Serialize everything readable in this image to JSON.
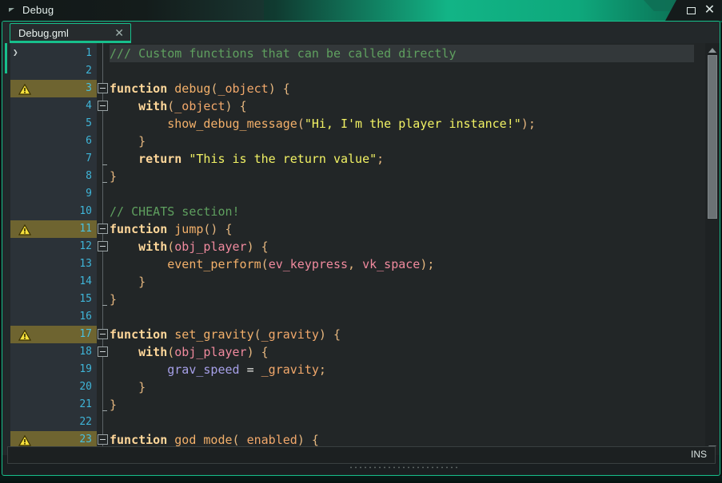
{
  "window": {
    "title": "Debug",
    "collapse_icon": "triangle-left-icon",
    "maximize_label": "maximize-icon",
    "close_label": "✕"
  },
  "tabs": [
    {
      "label": "Debug.gml",
      "close": "✕",
      "active": true
    }
  ],
  "status": {
    "insert_mode": "INS"
  },
  "scrollbar": {
    "up_arrow": "scroll-up-icon",
    "down_arrow": "scroll-down-icon"
  },
  "gutter": {
    "cursor_glyph": "❯",
    "warning_glyph": "warning-icon",
    "lines": [
      {
        "n": "1",
        "warn": false
      },
      {
        "n": "2",
        "warn": false
      },
      {
        "n": "3",
        "warn": true
      },
      {
        "n": "4",
        "warn": false
      },
      {
        "n": "5",
        "warn": false
      },
      {
        "n": "6",
        "warn": false
      },
      {
        "n": "7",
        "warn": false
      },
      {
        "n": "8",
        "warn": false
      },
      {
        "n": "9",
        "warn": false
      },
      {
        "n": "10",
        "warn": false
      },
      {
        "n": "11",
        "warn": true
      },
      {
        "n": "12",
        "warn": false
      },
      {
        "n": "13",
        "warn": false
      },
      {
        "n": "14",
        "warn": false
      },
      {
        "n": "15",
        "warn": false
      },
      {
        "n": "16",
        "warn": false
      },
      {
        "n": "17",
        "warn": true
      },
      {
        "n": "18",
        "warn": false
      },
      {
        "n": "19",
        "warn": false
      },
      {
        "n": "20",
        "warn": false
      },
      {
        "n": "21",
        "warn": false
      },
      {
        "n": "22",
        "warn": false
      },
      {
        "n": "23",
        "warn": true
      }
    ]
  },
  "code": {
    "language": "gml",
    "current_line": 1,
    "lines": [
      {
        "n": 1,
        "text": "/// Custom functions that can be called directly",
        "tokens": [
          {
            "t": "/// Custom functions that can be called directly",
            "c": "tk-comment"
          }
        ]
      },
      {
        "n": 2,
        "text": "",
        "tokens": []
      },
      {
        "n": 3,
        "text": "function debug(_object) {",
        "tokens": [
          {
            "t": "function",
            "c": "tk-keyword"
          },
          {
            "t": " ",
            "c": "tk-plain"
          },
          {
            "t": "debug",
            "c": "tk-func"
          },
          {
            "t": "(",
            "c": "tk-punct"
          },
          {
            "t": "_object",
            "c": "tk-var"
          },
          {
            "t": ")",
            "c": "tk-punct"
          },
          {
            "t": " ",
            "c": "tk-plain"
          },
          {
            "t": "{",
            "c": "tk-punct"
          }
        ]
      },
      {
        "n": 4,
        "text": "    with(_object) {",
        "tokens": [
          {
            "t": "    ",
            "c": "tk-plain"
          },
          {
            "t": "with",
            "c": "tk-keyword"
          },
          {
            "t": "(",
            "c": "tk-punct"
          },
          {
            "t": "_object",
            "c": "tk-var"
          },
          {
            "t": ")",
            "c": "tk-punct"
          },
          {
            "t": " ",
            "c": "tk-plain"
          },
          {
            "t": "{",
            "c": "tk-punct"
          }
        ]
      },
      {
        "n": 5,
        "text": "        show_debug_message(\"Hi, I'm the player instance!\");",
        "tokens": [
          {
            "t": "        ",
            "c": "tk-plain"
          },
          {
            "t": "show_debug_message",
            "c": "tk-func"
          },
          {
            "t": "(",
            "c": "tk-punct"
          },
          {
            "t": "\"Hi, I'm the player instance!\"",
            "c": "tk-string"
          },
          {
            "t": ")",
            "c": "tk-punct"
          },
          {
            "t": ";",
            "c": "tk-punct"
          }
        ]
      },
      {
        "n": 6,
        "text": "    }",
        "tokens": [
          {
            "t": "    ",
            "c": "tk-plain"
          },
          {
            "t": "}",
            "c": "tk-punct"
          }
        ]
      },
      {
        "n": 7,
        "text": "    return \"This is the return value\";",
        "tokens": [
          {
            "t": "    ",
            "c": "tk-plain"
          },
          {
            "t": "return",
            "c": "tk-keyword"
          },
          {
            "t": " ",
            "c": "tk-plain"
          },
          {
            "t": "\"This is the return value\"",
            "c": "tk-string"
          },
          {
            "t": ";",
            "c": "tk-punct"
          }
        ]
      },
      {
        "n": 8,
        "text": "}",
        "tokens": [
          {
            "t": "}",
            "c": "tk-punct"
          }
        ]
      },
      {
        "n": 9,
        "text": "",
        "tokens": []
      },
      {
        "n": 10,
        "text": "// CHEATS section!",
        "tokens": [
          {
            "t": "// CHEATS section!",
            "c": "tk-comment"
          }
        ]
      },
      {
        "n": 11,
        "text": "function jump() {",
        "tokens": [
          {
            "t": "function",
            "c": "tk-keyword"
          },
          {
            "t": " ",
            "c": "tk-plain"
          },
          {
            "t": "jump",
            "c": "tk-func"
          },
          {
            "t": "()",
            "c": "tk-punct"
          },
          {
            "t": " ",
            "c": "tk-plain"
          },
          {
            "t": "{",
            "c": "tk-punct"
          }
        ]
      },
      {
        "n": 12,
        "text": "    with(obj_player) {",
        "tokens": [
          {
            "t": "    ",
            "c": "tk-plain"
          },
          {
            "t": "with",
            "c": "tk-keyword"
          },
          {
            "t": "(",
            "c": "tk-punct"
          },
          {
            "t": "obj_player",
            "c": "tk-const"
          },
          {
            "t": ")",
            "c": "tk-punct"
          },
          {
            "t": " ",
            "c": "tk-plain"
          },
          {
            "t": "{",
            "c": "tk-punct"
          }
        ]
      },
      {
        "n": 13,
        "text": "        event_perform(ev_keypress, vk_space);",
        "tokens": [
          {
            "t": "        ",
            "c": "tk-plain"
          },
          {
            "t": "event_perform",
            "c": "tk-func"
          },
          {
            "t": "(",
            "c": "tk-punct"
          },
          {
            "t": "ev_keypress",
            "c": "tk-const"
          },
          {
            "t": ", ",
            "c": "tk-punct"
          },
          {
            "t": "vk_space",
            "c": "tk-const"
          },
          {
            "t": ")",
            "c": "tk-punct"
          },
          {
            "t": ";",
            "c": "tk-punct"
          }
        ]
      },
      {
        "n": 14,
        "text": "    }",
        "tokens": [
          {
            "t": "    ",
            "c": "tk-plain"
          },
          {
            "t": "}",
            "c": "tk-punct"
          }
        ]
      },
      {
        "n": 15,
        "text": "}",
        "tokens": [
          {
            "t": "}",
            "c": "tk-punct"
          }
        ]
      },
      {
        "n": 16,
        "text": "",
        "tokens": []
      },
      {
        "n": 17,
        "text": "function set_gravity(_gravity) {",
        "tokens": [
          {
            "t": "function",
            "c": "tk-keyword"
          },
          {
            "t": " ",
            "c": "tk-plain"
          },
          {
            "t": "set_gravity",
            "c": "tk-func"
          },
          {
            "t": "(",
            "c": "tk-punct"
          },
          {
            "t": "_gravity",
            "c": "tk-var"
          },
          {
            "t": ")",
            "c": "tk-punct"
          },
          {
            "t": " ",
            "c": "tk-plain"
          },
          {
            "t": "{",
            "c": "tk-punct"
          }
        ]
      },
      {
        "n": 18,
        "text": "    with(obj_player) {",
        "tokens": [
          {
            "t": "    ",
            "c": "tk-plain"
          },
          {
            "t": "with",
            "c": "tk-keyword"
          },
          {
            "t": "(",
            "c": "tk-punct"
          },
          {
            "t": "obj_player",
            "c": "tk-const"
          },
          {
            "t": ")",
            "c": "tk-punct"
          },
          {
            "t": " ",
            "c": "tk-plain"
          },
          {
            "t": "{",
            "c": "tk-punct"
          }
        ]
      },
      {
        "n": 19,
        "text": "        grav_speed = _gravity;",
        "tokens": [
          {
            "t": "        ",
            "c": "tk-plain"
          },
          {
            "t": "grav_speed",
            "c": "tk-inst"
          },
          {
            "t": " = ",
            "c": "tk-plain"
          },
          {
            "t": "_gravity",
            "c": "tk-var"
          },
          {
            "t": ";",
            "c": "tk-punct"
          }
        ]
      },
      {
        "n": 20,
        "text": "    }",
        "tokens": [
          {
            "t": "    ",
            "c": "tk-plain"
          },
          {
            "t": "}",
            "c": "tk-punct"
          }
        ]
      },
      {
        "n": 21,
        "text": "}",
        "tokens": [
          {
            "t": "}",
            "c": "tk-punct"
          }
        ]
      },
      {
        "n": 22,
        "text": "",
        "tokens": []
      },
      {
        "n": 23,
        "text": "function god_mode(_enabled) {",
        "tokens": [
          {
            "t": "function",
            "c": "tk-keyword"
          },
          {
            "t": " ",
            "c": "tk-plain"
          },
          {
            "t": "god_mode",
            "c": "tk-func"
          },
          {
            "t": "(",
            "c": "tk-punct"
          },
          {
            "t": "_enabled",
            "c": "tk-var"
          },
          {
            "t": ")",
            "c": "tk-punct"
          },
          {
            "t": " ",
            "c": "tk-plain"
          },
          {
            "t": "{",
            "c": "tk-punct"
          }
        ]
      }
    ],
    "fold_open_lines": [
      3,
      4,
      11,
      12,
      17,
      18,
      23
    ],
    "fold_end_lines": [
      7,
      8,
      15,
      21
    ]
  },
  "colors": {
    "accent": "#17c08c",
    "title_gradient_end": "#12b486",
    "editor_bg": "#222627",
    "gutter_bg": "#2b3238",
    "warning_row_bg": "#6e6430",
    "line_number": "#3fb5d8",
    "comment": "#5fa05f",
    "keyword": "#ffd79a",
    "function": "#f3b06a",
    "string": "#f2f264",
    "constant": "#f08a9e",
    "instance_var": "#a6a0e8",
    "local_var": "#f2a86b"
  }
}
